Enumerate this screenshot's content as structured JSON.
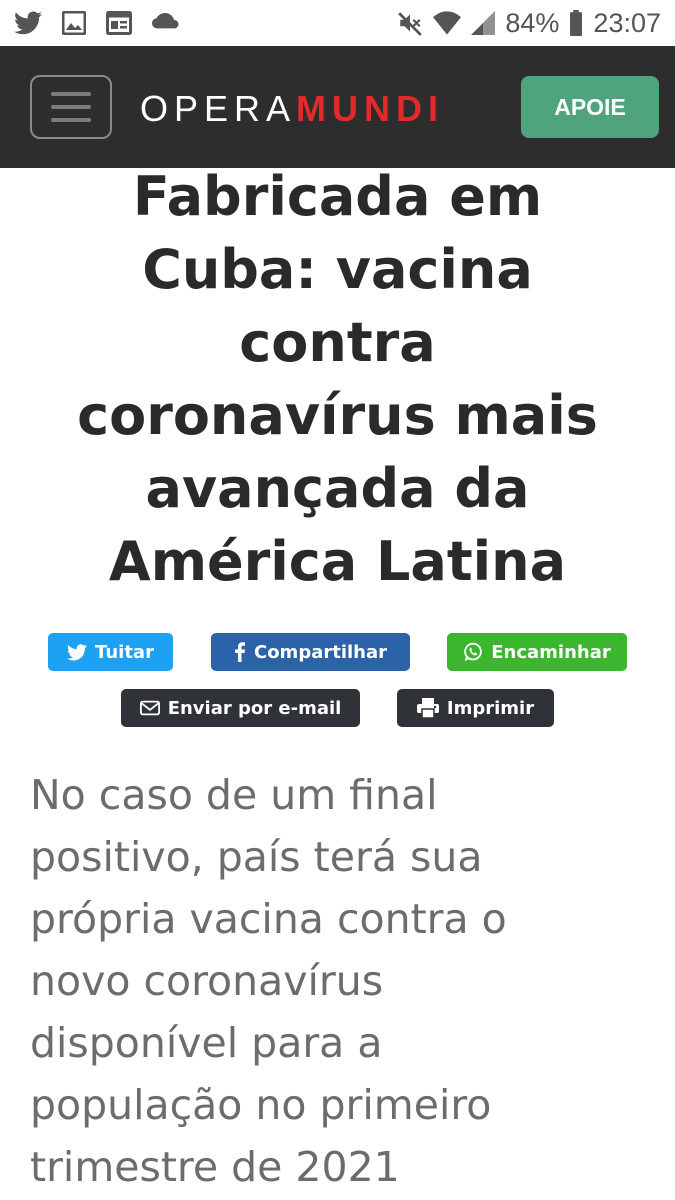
{
  "status_bar": {
    "battery": "84%",
    "time": "23:07"
  },
  "header": {
    "logo_part1": "OPERA",
    "logo_part2": "MUNDI",
    "support_label": "APOIE",
    "colors": {
      "background": "#2d2d2d",
      "accent_red": "#e32a2a",
      "support_green": "#4fa37d"
    }
  },
  "article": {
    "headline_lines": [
      "Fabricada em",
      "Cuba: vacina",
      "contra",
      "coronavírus mais",
      "avançada da",
      "América Latina"
    ],
    "lede_lines": [
      "No caso de um final",
      "positivo, país terá sua",
      "própria vacina contra o",
      "novo coronavírus",
      "disponível para a",
      "população no primeiro",
      "trimestre de 2021"
    ]
  },
  "share": {
    "twitter": "Tuitar",
    "facebook": "Compartilhar",
    "whatsapp": "Encaminhar",
    "email": "Enviar por e-mail",
    "print": "Imprimir",
    "colors": {
      "twitter": "#1da1f2",
      "facebook": "#2c62a8",
      "whatsapp": "#3cb52f",
      "dark": "#2f3236"
    }
  }
}
